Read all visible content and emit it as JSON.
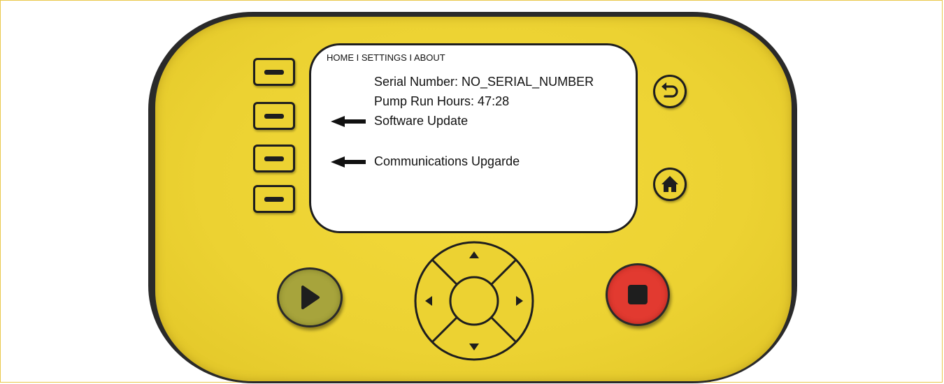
{
  "screen": {
    "breadcrumb": "HOME I SETTINGS I ABOUT",
    "serial_number": "Serial Number: NO_SERIAL_NUMBER",
    "pump_run_hours": "Pump Run Hours: 47:28",
    "software_update": "Software Update",
    "communications_upgrade": "Communications Upgarde"
  },
  "colors": {
    "device_yellow": "#ecd232",
    "play_green": "#a7a43c",
    "stop_red": "#e23a30",
    "outline": "#1e1e1e"
  },
  "icons": {
    "back": "back-arrow-icon",
    "home": "home-icon",
    "play": "play-icon",
    "stop": "stop-icon",
    "up": "triangle-up-icon",
    "down": "triangle-down-icon",
    "left": "triangle-left-icon",
    "right": "triangle-right-icon"
  }
}
